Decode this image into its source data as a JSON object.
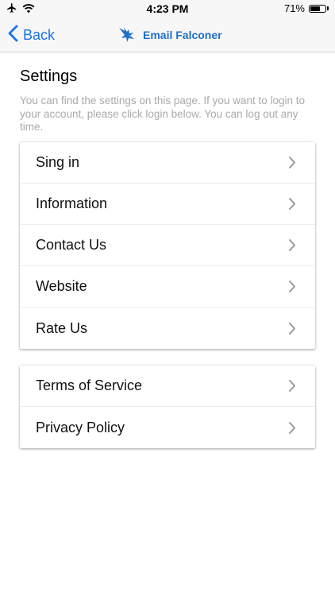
{
  "status_bar": {
    "time": "4:23 PM",
    "battery_percent": "71%",
    "battery_level": 0.71,
    "icons": [
      "airplane-icon",
      "wifi-icon",
      "battery-icon"
    ]
  },
  "nav": {
    "back_label": "Back",
    "title": "Email Falconer",
    "accent_color": "#1a73e8"
  },
  "settings": {
    "title": "Settings",
    "description": "You can find the settings on this page. If you want to login to your account, please click login below. You can log out any time."
  },
  "groups": [
    {
      "items": [
        {
          "label": "Sing in"
        },
        {
          "label": "Information"
        },
        {
          "label": "Contact Us"
        },
        {
          "label": "Website"
        },
        {
          "label": "Rate Us"
        }
      ]
    },
    {
      "items": [
        {
          "label": "Terms of Service"
        },
        {
          "label": "Privacy Policy"
        }
      ]
    }
  ]
}
